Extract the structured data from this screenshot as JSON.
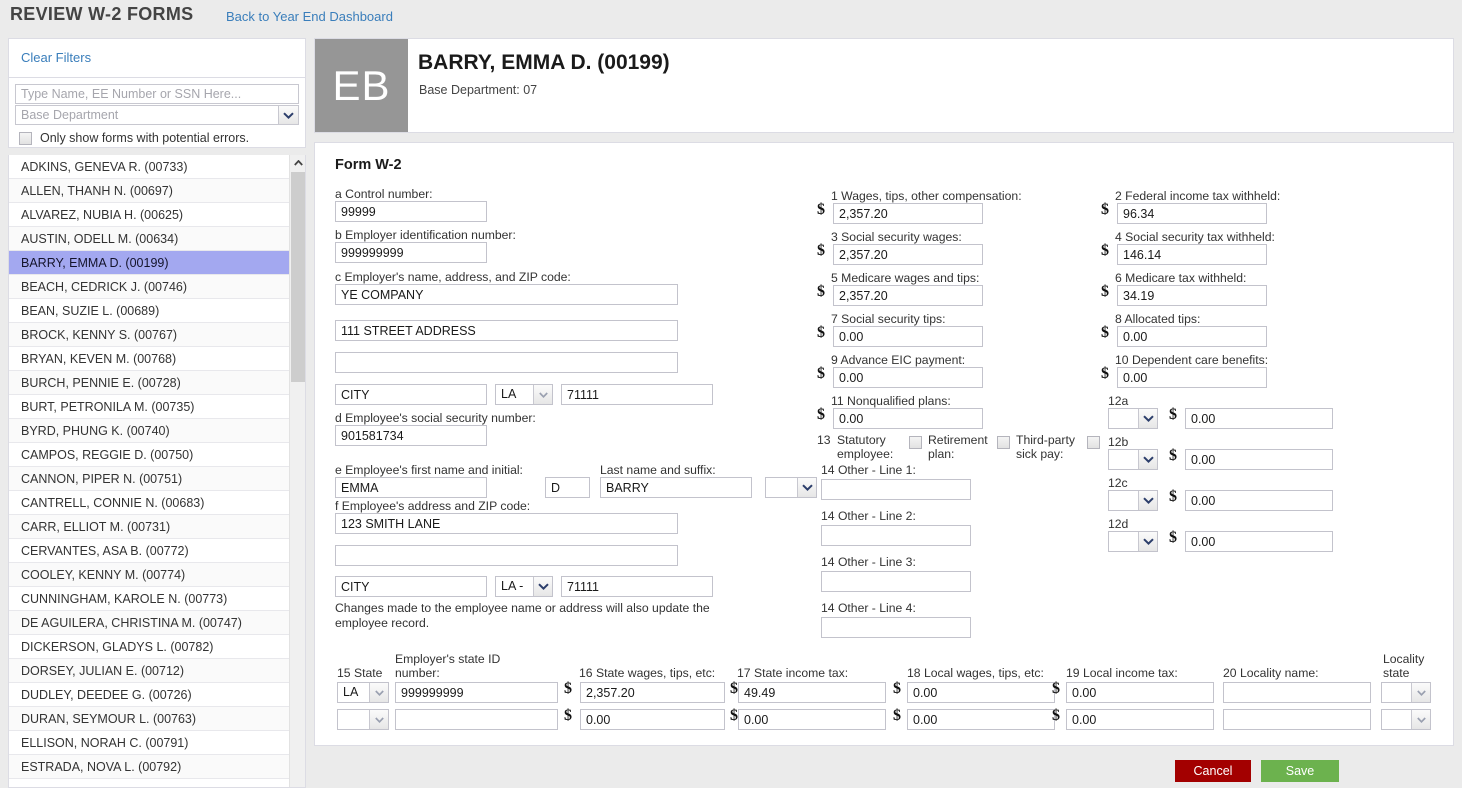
{
  "header": {
    "title": "REVIEW W-2 FORMS",
    "back_link": "Back to Year End Dashboard"
  },
  "filters": {
    "clear_filters": "Clear Filters",
    "search_placeholder": "Type Name, EE Number or SSN Here...",
    "department_select": "Base Department",
    "errors_checkbox_label": "Only show forms with potential errors.",
    "errors_checked": false
  },
  "employee_list": [
    "ADKINS, GENEVA R. (00733)",
    "ALLEN, THANH N. (00697)",
    "ALVAREZ, NUBIA H. (00625)",
    "AUSTIN, ODELL M. (00634)",
    "BARRY, EMMA D. (00199)",
    "BEACH, CEDRICK J. (00746)",
    "BEAN, SUZIE L. (00689)",
    "BROCK, KENNY S. (00767)",
    "BRYAN, KEVEN M. (00768)",
    "BURCH, PENNIE E. (00728)",
    "BURT, PETRONILA M. (00735)",
    "BYRD, PHUNG K. (00740)",
    "CAMPOS, REGGIE D. (00750)",
    "CANNON, PIPER N. (00751)",
    "CANTRELL, CONNIE N. (00683)",
    "CARR, ELLIOT M. (00731)",
    "CERVANTES, ASA B. (00772)",
    "COOLEY, KENNY M. (00774)",
    "CUNNINGHAM, KAROLE N. (00773)",
    "DE AGUILERA, CHRISTINA M. (00747)",
    "DICKERSON, GLADYS L. (00782)",
    "DORSEY, JULIAN E. (00712)",
    "DUDLEY, DEEDEE G. (00726)",
    "DURAN, SEYMOUR L. (00763)",
    "ELLISON, NORAH C. (00791)",
    "ESTRADA, NOVA L. (00792)"
  ],
  "selected_index": 4,
  "employee": {
    "initials": "EB",
    "name": "BARRY, EMMA D. (00199)",
    "base_department": "Base Department: 07"
  },
  "form": {
    "title": "Form W-2",
    "a_label": "a Control number:",
    "a_value": "99999",
    "b_label": "b Employer identification number:",
    "b_value": "999999999",
    "c_label": "c Employer's name, address, and ZIP code:",
    "c_name": "YE COMPANY",
    "c_addr1": "111 STREET ADDRESS",
    "c_addr2": "",
    "c_city": "CITY",
    "c_state": "LA",
    "c_zip": "71111",
    "d_label": "d Employee's social security number:",
    "d_value": "901581734",
    "e_label": "e Employee's first name and initial:",
    "e_first": "EMMA",
    "e_initial": "D",
    "last_name_label": "Last name and suffix:",
    "e_last": "BARRY",
    "e_suffix": "",
    "f_label": "f Employee's address and ZIP code:",
    "f_addr1": "123 SMITH LANE",
    "f_addr2": "",
    "f_city": "CITY",
    "f_state": "LA -",
    "f_zip": "71111",
    "change_note": "Changes made to the employee name or address will also update the employee record.",
    "box1_label": "1 Wages, tips, other compensation:",
    "box1_value": "2,357.20",
    "box2_label": "2 Federal income tax withheld:",
    "box2_value": "96.34",
    "box3_label": "3 Social security wages:",
    "box3_value": "2,357.20",
    "box4_label": "4 Social security tax withheld:",
    "box4_value": "146.14",
    "box5_label": "5 Medicare wages and tips:",
    "box5_value": "2,357.20",
    "box6_label": "6 Medicare tax withheld:",
    "box6_value": "34.19",
    "box7_label": "7 Social security tips:",
    "box7_value": "0.00",
    "box8_label": "8 Allocated tips:",
    "box8_value": "0.00",
    "box9_label": "9 Advance EIC payment:",
    "box9_value": "0.00",
    "box10_label": "10 Dependent care benefits:",
    "box10_value": "0.00",
    "box11_label": "11 Nonqualified plans:",
    "box11_value": "0.00",
    "box13_num": "13",
    "box13_statutory": "Statutory employee:",
    "box13_retirement": "Retirement plan:",
    "box13_thirdparty": "Third-party sick pay:",
    "box13_statutory_checked": false,
    "box13_retirement_checked": false,
    "box13_thirdparty_checked": false,
    "box12a_label": "12a",
    "box12a_code": "",
    "box12a_value": "0.00",
    "box12b_label": "12b",
    "box12b_code": "",
    "box12b_value": "0.00",
    "box12c_label": "12c",
    "box12c_code": "",
    "box12c_value": "0.00",
    "box12d_label": "12d",
    "box12d_code": "",
    "box12d_value": "0.00",
    "box14_line1_label": "14 Other - Line 1:",
    "box14_line1_value": "",
    "box14_line2_label": "14 Other - Line 2:",
    "box14_line2_value": "",
    "box14_line3_label": "14 Other - Line 3:",
    "box14_line3_value": "",
    "box14_line4_label": "14 Other - Line 4:",
    "box14_line4_value": "",
    "box15_label": "15 State",
    "employer_state_id_label_1": "Employer's state ID",
    "employer_state_id_label_2": "number:",
    "box16_label": "16 State wages, tips, etc:",
    "box17_label": "17 State income tax:",
    "box18_label": "18 Local wages, tips, etc:",
    "box19_label": "19 Local income tax:",
    "box20_label": "20 Locality name:",
    "locality_state_label_1": "Locality",
    "locality_state_label_2": "state",
    "row1_state": "LA",
    "row1_employer_id": "999999999",
    "row1_state_wages": "2,357.20",
    "row1_state_tax": "49.49",
    "row1_local_wages": "0.00",
    "row1_local_tax": "0.00",
    "row1_locality_name": "",
    "row1_locality_state": "",
    "row2_state": "",
    "row2_employer_id": "",
    "row2_state_wages": "0.00",
    "row2_state_tax": "0.00",
    "row2_local_wages": "0.00",
    "row2_local_tax": "0.00",
    "row2_locality_name": "",
    "row2_locality_state": ""
  },
  "footer": {
    "cancel_label": "Cancel",
    "save_label": "Save"
  },
  "colors": {
    "accent_link": "#3a7ebb",
    "selected_row": "#a3a8f0",
    "avatar_bg": "#969696",
    "cancel_bg": "#a30000",
    "save_bg": "#6cb24e",
    "page_bg": "#ebebeb"
  }
}
